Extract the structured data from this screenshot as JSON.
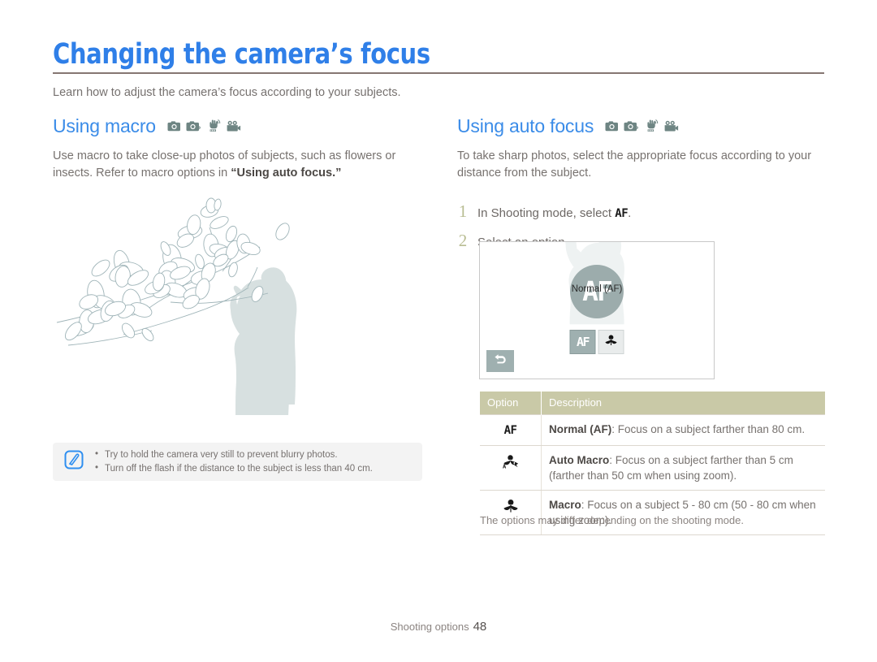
{
  "document": {
    "title": "Changing the camera’s focus",
    "subtitle": "Learn how to adjust the camera’s focus according to your subjects.",
    "accent_color": "#2f7fe8",
    "rule_color": "#857672"
  },
  "left_section": {
    "heading": "Using macro",
    "mode_icons": [
      "camera-auto-icon",
      "camera-program-icon",
      "dual-is-icon",
      "movie-icon"
    ],
    "body_part1": "Use macro to take close-up photos of subjects, such as flowers or insects. Refer to macro options in ",
    "body_bold": "“Using auto focus.”",
    "illustration": "magnolia-branch-and-photographer-silhouette"
  },
  "note": {
    "icon": "note-pencil-icon",
    "items": [
      "Try to hold the camera very still to prevent blurry photos.",
      "Turn off the flash if the distance to the subject is less than 40 cm."
    ]
  },
  "right_section": {
    "heading": "Using auto focus",
    "mode_icons": [
      "camera-auto-icon",
      "camera-program-icon",
      "dual-is-icon",
      "movie-icon"
    ],
    "body": "To take sharp photos, select the appropriate focus according to your distance from the subject.",
    "steps": [
      {
        "num": "1",
        "text_before": "In Shooting mode, select ",
        "glyph": "AF",
        "text_after": "."
      },
      {
        "num": "2",
        "text_before": "Select an option.",
        "glyph": "",
        "text_after": ""
      }
    ]
  },
  "camera_screen": {
    "focus_label": "Normal (AF)",
    "center_glyph": "AF",
    "buttons": [
      {
        "name": "af-option-button",
        "glyph": "AF",
        "selected": true
      },
      {
        "name": "macro-option-button",
        "glyph": "macro-flower-icon",
        "selected": false
      }
    ],
    "back_button": "back-arrow-icon",
    "circle_color": "#8ea0a0",
    "selected_button_color": "#9fb0b0"
  },
  "table": {
    "header_color": "#c9c9a7",
    "columns": [
      "Option",
      "Description"
    ],
    "rows": [
      {
        "icon": "af-icon",
        "icon_text": "AF",
        "term": "Normal (AF)",
        "description": ": Focus on a subject farther than 80 cm."
      },
      {
        "icon": "auto-macro-icon",
        "icon_text": "",
        "term": "Auto Macro",
        "description": ": Focus on a subject farther than 5 cm (farther than 50 cm when using zoom)."
      },
      {
        "icon": "macro-icon",
        "icon_text": "",
        "term": "Macro",
        "description": ": Focus on a subject 5 - 80 cm (50 - 80 cm when using zoom)."
      }
    ],
    "caption": "The options may differ depending on the shooting mode."
  },
  "footer": {
    "label": "Shooting options",
    "page_number": "48"
  }
}
